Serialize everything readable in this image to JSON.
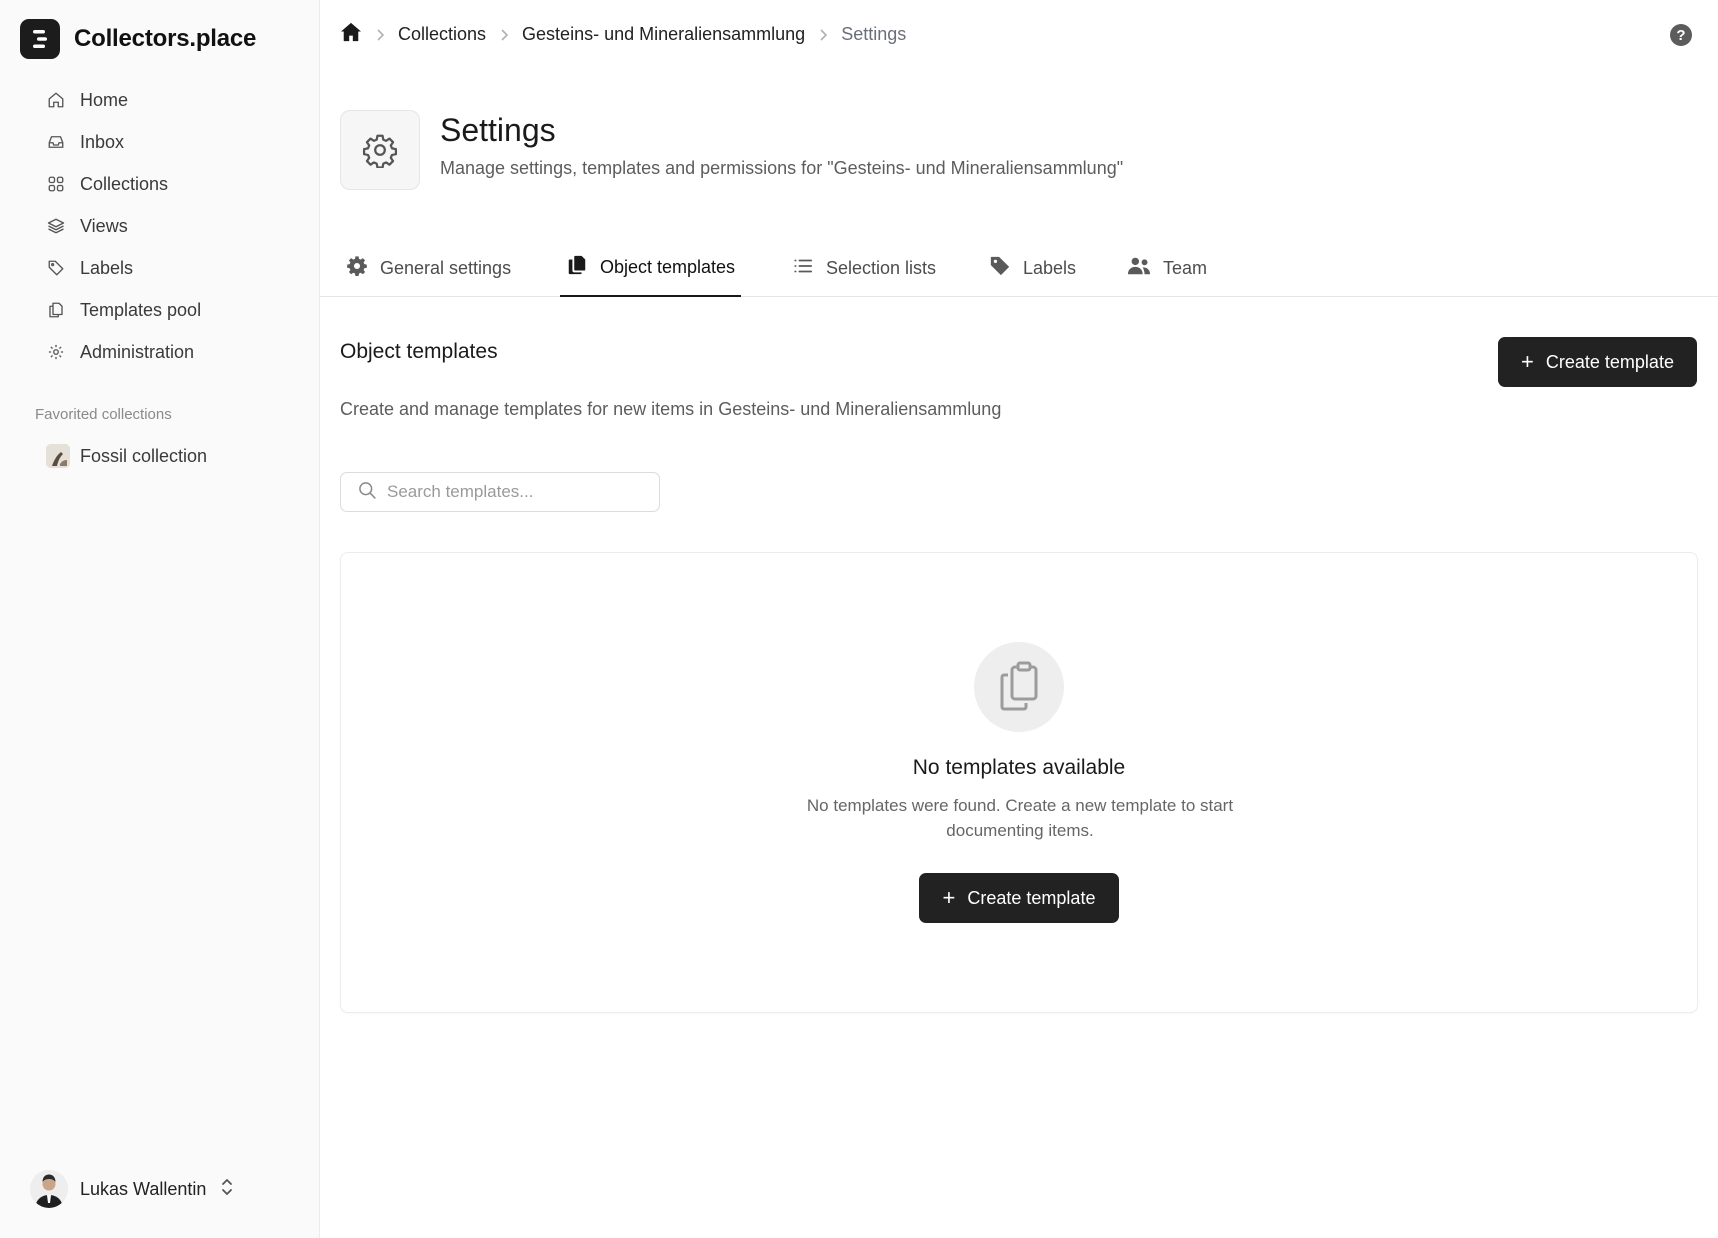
{
  "app": {
    "name": "Collectors.place"
  },
  "sidebar": {
    "items": [
      {
        "label": "Home",
        "icon": "home-icon"
      },
      {
        "label": "Inbox",
        "icon": "inbox-icon"
      },
      {
        "label": "Collections",
        "icon": "grid-icon"
      },
      {
        "label": "Views",
        "icon": "layers-icon"
      },
      {
        "label": "Labels",
        "icon": "tag-icon"
      },
      {
        "label": "Templates pool",
        "icon": "copy-icon"
      },
      {
        "label": "Administration",
        "icon": "gear-icon"
      }
    ],
    "favorites_heading": "Favorited collections",
    "favorites": [
      {
        "label": "Fossil collection"
      }
    ],
    "user": {
      "name": "Lukas Wallentin"
    }
  },
  "breadcrumb": {
    "items": [
      "Collections",
      "Gesteins- und Mineraliensammlung",
      "Settings"
    ]
  },
  "header": {
    "title": "Settings",
    "subtitle": "Manage settings, templates and permissions for \"Gesteins- und Mineraliensammlung\""
  },
  "tabs": [
    {
      "label": "General settings",
      "icon": "gear-icon"
    },
    {
      "label": "Object templates",
      "icon": "copy-icon",
      "active": true
    },
    {
      "label": "Selection lists",
      "icon": "list-icon"
    },
    {
      "label": "Labels",
      "icon": "tag-icon"
    },
    {
      "label": "Team",
      "icon": "users-icon"
    }
  ],
  "section": {
    "title": "Object templates",
    "description": "Create and manage templates for new items in Gesteins- und Mineraliensammlung",
    "create_label": "Create template",
    "search_placeholder": "Search templates..."
  },
  "empty_state": {
    "title": "No templates available",
    "description": "No templates were found. Create a new template to start documenting items.",
    "button_label": "Create template"
  },
  "colors": {
    "accent": "#222222",
    "muted": "#6a6f7b"
  }
}
